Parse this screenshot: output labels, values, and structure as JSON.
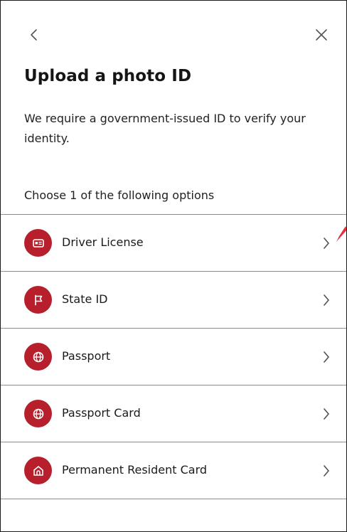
{
  "header": {
    "title": "Upload a photo ID",
    "description": "We require a government-issued ID to verify your identity."
  },
  "choose_text": "Choose 1 of the following options",
  "options": [
    {
      "label": "Driver License",
      "icon": "id-card-icon"
    },
    {
      "label": "State ID",
      "icon": "flag-icon"
    },
    {
      "label": "Passport",
      "icon": "globe-icon"
    },
    {
      "label": "Passport Card",
      "icon": "globe-icon"
    },
    {
      "label": "Permanent Resident Card",
      "icon": "home-icon"
    }
  ],
  "colors": {
    "accent": "#b81f2c",
    "text": "#1a1a1a",
    "divider": "#8a8a8a",
    "cursor": "#e0182d"
  }
}
